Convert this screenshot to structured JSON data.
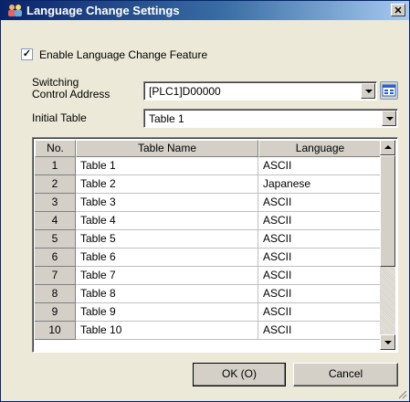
{
  "window": {
    "title": "Language Change Settings",
    "close_glyph": "✕"
  },
  "enable_feature": {
    "label": "Enable Language Change Feature",
    "checked": true,
    "check_glyph": "✓"
  },
  "switching_address": {
    "label_line1": "Switching",
    "label_line2": "Control Address",
    "value": "[PLC1]D00000"
  },
  "initial_table": {
    "label": "Initial Table",
    "value": "Table 1"
  },
  "table": {
    "columns": [
      "No.",
      "Table Name",
      "Language"
    ],
    "rows": [
      {
        "no": "1",
        "name": "Table 1",
        "language": "ASCII"
      },
      {
        "no": "2",
        "name": "Table 2",
        "language": "Japanese"
      },
      {
        "no": "3",
        "name": "Table 3",
        "language": "ASCII"
      },
      {
        "no": "4",
        "name": "Table 4",
        "language": "ASCII"
      },
      {
        "no": "5",
        "name": "Table 5",
        "language": "ASCII"
      },
      {
        "no": "6",
        "name": "Table 6",
        "language": "ASCII"
      },
      {
        "no": "7",
        "name": "Table 7",
        "language": "ASCII"
      },
      {
        "no": "8",
        "name": "Table 8",
        "language": "ASCII"
      },
      {
        "no": "9",
        "name": "Table 9",
        "language": "ASCII"
      },
      {
        "no": "10",
        "name": "Table 10",
        "language": "ASCII"
      }
    ]
  },
  "buttons": {
    "ok": "OK (O)",
    "cancel": "Cancel"
  },
  "colors": {
    "titlebar_start": "#0a246a",
    "titlebar_end": "#a6caf0",
    "dialog_bg": "#ece9d8"
  },
  "icons": {
    "app": "settings-people-icon",
    "address_picker": "address-input-icon",
    "resize": "resize-grip-icon"
  }
}
